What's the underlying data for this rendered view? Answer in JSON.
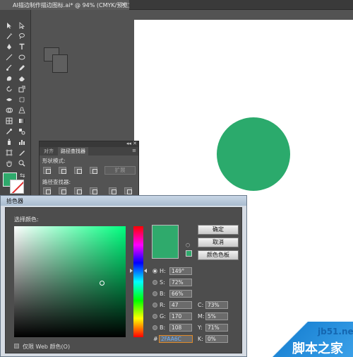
{
  "document_tab": {
    "title": "AI描边制作描边图标.ai* @ 94% (CMYK/预览)",
    "close_glyph": "×"
  },
  "colors": {
    "fill": "#2FAA6C",
    "circle": "#2BAA6C",
    "artboard": "#FFFFFF",
    "workspace": "#535353"
  },
  "tools": [
    "selection-tool",
    "direct-selection-tool",
    "magic-wand-tool",
    "lasso-tool",
    "pen-tool",
    "type-tool",
    "line-tool",
    "ellipse-tool",
    "paintbrush-tool",
    "pencil-tool",
    "blob-brush-tool",
    "eraser-tool",
    "rotate-tool",
    "scale-tool",
    "width-tool",
    "free-transform-tool",
    "shape-builder-tool",
    "perspective-grid-tool",
    "mesh-tool",
    "gradient-tool",
    "eyedropper-tool",
    "blend-tool",
    "symbol-sprayer-tool",
    "column-graph-tool",
    "artboard-tool",
    "slice-tool",
    "hand-tool",
    "zoom-tool"
  ],
  "pathfinder": {
    "tabs": [
      "对齐",
      "路径查找器"
    ],
    "shape_modes_label": "形状模式:",
    "expand_label": "扩展",
    "pathfinders_label": "路径查找器:"
  },
  "color_picker": {
    "title": "拾色器",
    "select_color_label": "选择颜色:",
    "buttons": {
      "ok": "确定",
      "cancel": "取消",
      "swatches": "颜色色板"
    },
    "fields": {
      "H": {
        "label": "H:",
        "value": "149°"
      },
      "S": {
        "label": "S:",
        "value": "72%"
      },
      "B": {
        "label": "B:",
        "value": "66%"
      },
      "R": {
        "label": "R:",
        "value": "47"
      },
      "G": {
        "label": "G:",
        "value": "170"
      },
      "Bl": {
        "label": "B:",
        "value": "108"
      },
      "C": {
        "label": "C:",
        "value": "73%"
      },
      "M": {
        "label": "M:",
        "value": "5%"
      },
      "Y": {
        "label": "Y:",
        "value": "71%"
      },
      "K": {
        "label": "K:",
        "value": "0%"
      },
      "hex": {
        "label": "#",
        "value": "2FAA6C"
      }
    },
    "selected_mode": "H",
    "web_only_label": "仅限 Web 颜色(O)",
    "web_only_checked": false
  },
  "watermark": {
    "site": "jb51.net",
    "name": "脚本之家"
  }
}
